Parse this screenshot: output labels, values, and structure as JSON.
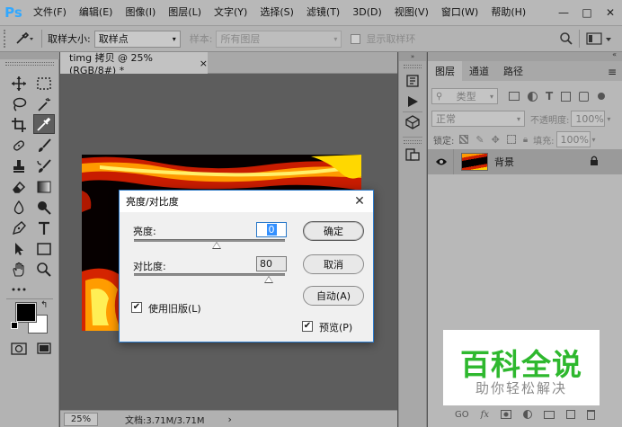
{
  "app": {
    "logo": "Ps"
  },
  "menu": [
    "文件(F)",
    "编辑(E)",
    "图像(I)",
    "图层(L)",
    "文字(Y)",
    "选择(S)",
    "滤镜(T)",
    "3D(D)",
    "视图(V)",
    "窗口(W)",
    "帮助(H)"
  ],
  "window_controls": {
    "minimize": "—",
    "maximize": "□",
    "close": "✕"
  },
  "options_bar": {
    "sample_size_label": "取样大小:",
    "sample_size_value": "取样点",
    "sample_label": "样本:",
    "sample_value": "所有图层",
    "show_ring_label": "显示取样环"
  },
  "document": {
    "tab_title": "timg 拷贝 @ 25%(RGB/8#) *",
    "tab_close": "×",
    "zoom": "25%",
    "doc_size": "文档:3.71M/3.71M",
    "nav_arrow": "›"
  },
  "layers_panel": {
    "tabs": [
      "图层",
      "通道",
      "路径"
    ],
    "active_tab": "图层",
    "filter_label": "类型",
    "blend_mode": "正常",
    "opacity_label": "不透明度:",
    "opacity_value": "100%",
    "lock_label": "锁定:",
    "fill_label": "填充:",
    "fill_value": "100%",
    "layer_name": "背景",
    "footer_icons": [
      "GO",
      "fx"
    ]
  },
  "dialog": {
    "title": "亮度/对比度",
    "close": "✕",
    "brightness_label": "亮度:",
    "brightness_value": "0",
    "brightness_level": 0.55,
    "contrast_label": "对比度:",
    "contrast_value": "80",
    "contrast_level": 0.89,
    "legacy_label": "使用旧版(L)",
    "legacy_checked": true,
    "preview_label": "预览(P)",
    "preview_checked": true,
    "ok_label": "确定",
    "cancel_label": "取消",
    "auto_label": "自动(A)"
  },
  "watermark": {
    "title": "百科全说",
    "subtitle": "助你轻松解决"
  },
  "colors": {
    "accent_blue": "#2b79c9",
    "watermark_green": "#2eb82e",
    "ps_blue": "#31a8ff"
  }
}
